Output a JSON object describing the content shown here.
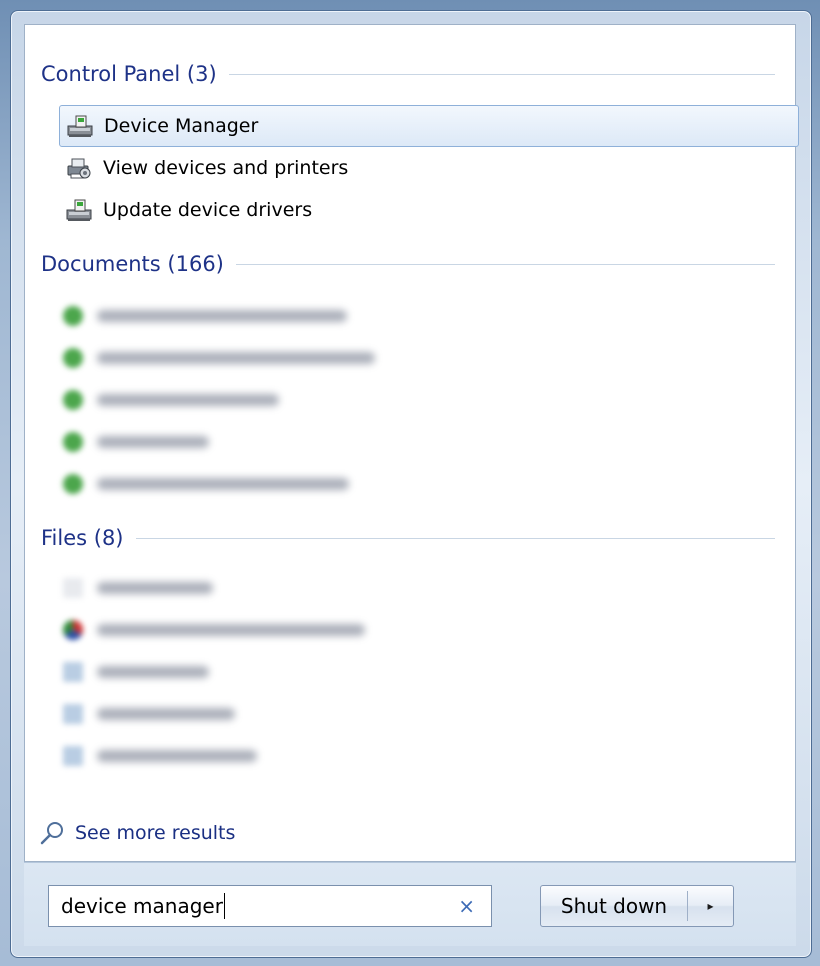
{
  "sections": [
    {
      "title": "Control Panel (3)",
      "items": [
        {
          "label": "Device Manager",
          "icon": "device-manager-icon",
          "selected": true
        },
        {
          "label": "View devices and printers",
          "icon": "printer-icon",
          "selected": false
        },
        {
          "label": "Update device drivers",
          "icon": "device-manager-icon",
          "selected": false
        }
      ]
    },
    {
      "title": "Documents (166)"
    },
    {
      "title": "Files (8)"
    }
  ],
  "see_more": "See more results",
  "search": {
    "value": "device manager"
  },
  "clear_glyph": "×",
  "shutdown": {
    "label": "Shut down",
    "arrow": "▸"
  },
  "colors": {
    "header": "#1e3287",
    "selection_border": "#8eb0d9"
  }
}
